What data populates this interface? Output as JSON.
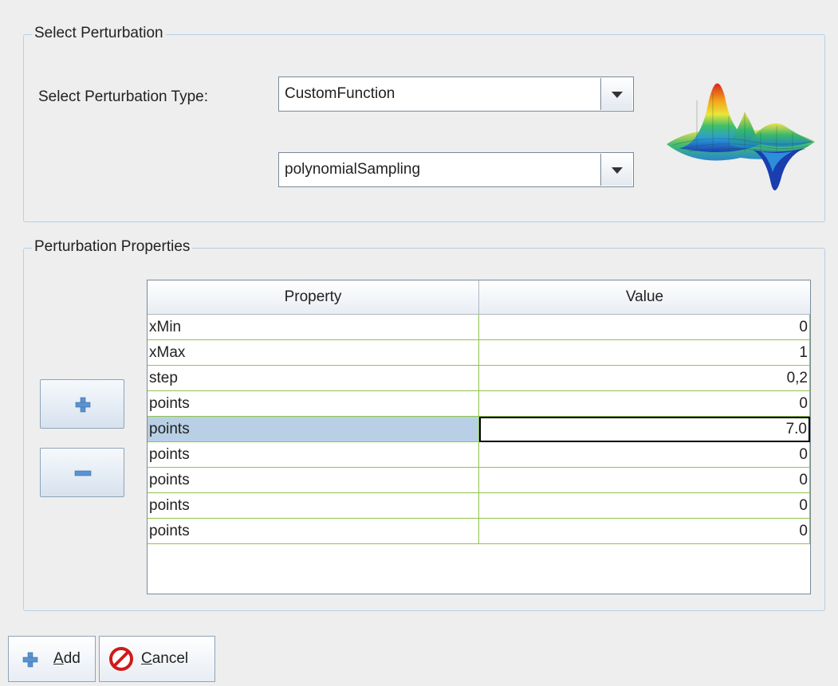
{
  "select_group": {
    "title": "Select Perturbation",
    "type_label": "Select Perturbation Type:",
    "type_combo_value": "CustomFunction",
    "subtype_combo_value": "polynomialSampling"
  },
  "props_group": {
    "title": "Perturbation Properties",
    "columns": {
      "property": "Property",
      "value": "Value"
    },
    "rows": [
      {
        "property": "xMin",
        "value": "0"
      },
      {
        "property": "xMax",
        "value": "1"
      },
      {
        "property": "step",
        "value": "0,2"
      },
      {
        "property": "points",
        "value": "0"
      },
      {
        "property": "points",
        "value": "7.0"
      },
      {
        "property": "points",
        "value": "0"
      },
      {
        "property": "points",
        "value": "0"
      },
      {
        "property": "points",
        "value": "0"
      },
      {
        "property": "points",
        "value": "0"
      }
    ]
  },
  "buttons": {
    "add_mnemonic": "A",
    "add_rest": "dd",
    "cancel_mnemonic": "C",
    "cancel_rest": "ancel"
  },
  "icons": {
    "add_row": "plus-icon",
    "remove_row": "minus-icon",
    "add": "plus-icon",
    "cancel": "cancel-icon",
    "surface": "surface-plot-icon"
  },
  "colors": {
    "group_border": "#b8cfe5",
    "grid_line": "#8fc44b",
    "selection": "#b8cfe5",
    "plus": "#4a86c8"
  }
}
